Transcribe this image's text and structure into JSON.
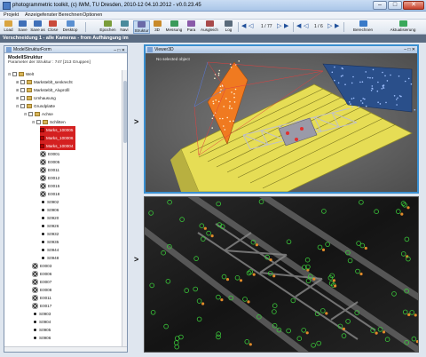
{
  "window": {
    "title": "photogrammetric toolkit, (c) IWM, TU Dresden, 2010-12  04.10.2012 - v0.0.23.45",
    "minimize": "–",
    "maximize": "□",
    "close": "✕"
  },
  "menu": [
    "Projekt",
    "Anzeigefenster",
    "Berechnen",
    "Optionen"
  ],
  "toolbar": {
    "buttons": [
      {
        "label": "Load",
        "icon": "folder-open-icon",
        "color": "#d9a441"
      },
      {
        "label": "Save",
        "icon": "save-icon",
        "color": "#3f6fb8"
      },
      {
        "label": "Save as",
        "icon": "save-as-icon",
        "color": "#3f6fb8"
      },
      {
        "label": "Close",
        "icon": "close-doc-icon",
        "color": "#c94a3a"
      },
      {
        "label": "Desktop",
        "icon": "desktop-icon",
        "color": "#5a8fd0"
      },
      {
        "label": "Epochen",
        "icon": "epochs-icon",
        "color": "#7a9c3a"
      },
      {
        "label": "Navi",
        "icon": "navigation-icon",
        "color": "#4a8a9c"
      },
      {
        "label": "Struktur",
        "icon": "structure-icon",
        "color": "#6a6aa8"
      },
      {
        "label": "3D",
        "icon": "cube-3d-icon",
        "color": "#c98a2a"
      },
      {
        "label": "Messung",
        "icon": "measure-icon",
        "color": "#3a9a5a"
      },
      {
        "label": "Para",
        "icon": "parameters-icon",
        "color": "#8a5aa8"
      },
      {
        "label": "Ausgleich",
        "icon": "adjustment-icon",
        "color": "#a84a4a"
      },
      {
        "label": "Log",
        "icon": "log-icon",
        "color": "#5a6a7a"
      }
    ],
    "counter1": "1 / 77",
    "counter2": "1 / 6",
    "berechnen": {
      "label": "Berechnen",
      "icon": "calculate-icon",
      "color": "#3a7ac8"
    },
    "aktualisierung": {
      "label": "Aktualisierung",
      "icon": "refresh-icon",
      "color": "#3aa85a"
    }
  },
  "breadcrumb": "Verschneidung 1 - alle Kameras - from Aufhängung im",
  "left_panel": {
    "header": "ModelStrukturForm",
    "title": "ModellStruktur",
    "subtitle": "Parameter der Struktur : 747  [213 Gruppen]",
    "tree": [
      {
        "label": "Welt",
        "indent": 0,
        "kind": "folder",
        "expander": "⊟"
      },
      {
        "label": "Marksteblt_senkrecht",
        "indent": 1,
        "kind": "folder",
        "expander": "⊞"
      },
      {
        "label": "Marksteblt_Aluprofil",
        "indent": 1,
        "kind": "folder",
        "expander": "⊞"
      },
      {
        "label": "Umhausung",
        "indent": 1,
        "kind": "folder",
        "expander": "⊞"
      },
      {
        "label": "Grundplatte",
        "indent": 1,
        "kind": "folder",
        "expander": "⊟"
      },
      {
        "label": "Achse",
        "indent": 2,
        "kind": "folder",
        "expander": "⊟"
      },
      {
        "label": "Schlitten",
        "indent": 3,
        "kind": "folder",
        "expander": "⊟"
      },
      {
        "label": "Marks_100005",
        "indent": 4,
        "kind": "red"
      },
      {
        "label": "Marks_100006",
        "indent": 4,
        "kind": "red"
      },
      {
        "label": "Marks_100004",
        "indent": 4,
        "kind": "red"
      },
      {
        "label": "E0001",
        "indent": 4,
        "kind": "target"
      },
      {
        "label": "E0005",
        "indent": 4,
        "kind": "target"
      },
      {
        "label": "E0011",
        "indent": 4,
        "kind": "target"
      },
      {
        "label": "E0012",
        "indent": 4,
        "kind": "target"
      },
      {
        "label": "E0015",
        "indent": 4,
        "kind": "target"
      },
      {
        "label": "E0018",
        "indent": 4,
        "kind": "target"
      },
      {
        "label": "S0902",
        "indent": 4,
        "kind": "dot"
      },
      {
        "label": "S0906",
        "indent": 4,
        "kind": "dot"
      },
      {
        "label": "S0920",
        "indent": 4,
        "kind": "dot"
      },
      {
        "label": "S0926",
        "indent": 4,
        "kind": "dot"
      },
      {
        "label": "S0932",
        "indent": 4,
        "kind": "dot"
      },
      {
        "label": "S0935",
        "indent": 4,
        "kind": "dot"
      },
      {
        "label": "S0944",
        "indent": 4,
        "kind": "dot"
      },
      {
        "label": "S0948",
        "indent": 4,
        "kind": "dot"
      },
      {
        "label": "E0003",
        "indent": 3,
        "kind": "target"
      },
      {
        "label": "E0006",
        "indent": 3,
        "kind": "target"
      },
      {
        "label": "E0007",
        "indent": 3,
        "kind": "target"
      },
      {
        "label": "E0008",
        "indent": 3,
        "kind": "target"
      },
      {
        "label": "E0011",
        "indent": 3,
        "kind": "target"
      },
      {
        "label": "E0017",
        "indent": 3,
        "kind": "target"
      },
      {
        "label": "S0903",
        "indent": 3,
        "kind": "dot"
      },
      {
        "label": "S0904",
        "indent": 3,
        "kind": "dot"
      },
      {
        "label": "S0905",
        "indent": 3,
        "kind": "dot"
      },
      {
        "label": "S0906",
        "indent": 3,
        "kind": "dot"
      }
    ]
  },
  "viewer3d": {
    "header": "Viewer3D",
    "message": "No selected object"
  },
  "colors": {
    "accent": "#3a8fd0",
    "selection_red": "#d42020",
    "point_green": "#3ac83a",
    "wireframe_red": "#e03030",
    "plane_orange": "#f07a20",
    "plane_blue": "#2a4f8a",
    "rail_yellow": "#e8e05a"
  }
}
